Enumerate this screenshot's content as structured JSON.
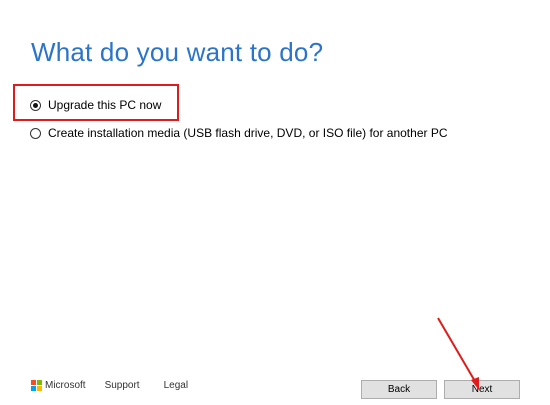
{
  "header": {
    "title": "What do you want to do?"
  },
  "options": [
    {
      "label": "Upgrade this PC now",
      "selected": true
    },
    {
      "label": "Create installation media (USB flash drive, DVD, or ISO file) for another PC",
      "selected": false
    }
  ],
  "footer": {
    "brand": "Microsoft",
    "support": "Support",
    "legal": "Legal"
  },
  "buttons": {
    "back": "Back",
    "next": "Next"
  },
  "colors": {
    "title": "#2c74c9",
    "annotation": "#e01b1b",
    "ms_red": "#f25022",
    "ms_green": "#7fba00",
    "ms_blue": "#00a4ef",
    "ms_yellow": "#ffb900"
  }
}
